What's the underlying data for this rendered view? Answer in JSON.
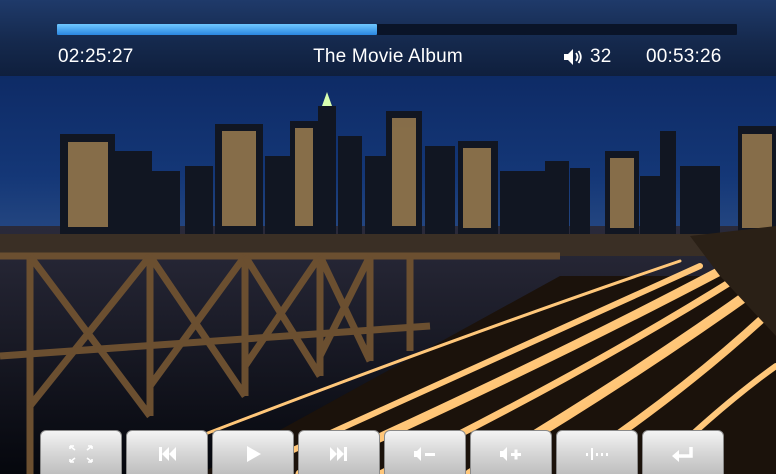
{
  "player": {
    "title": "The Movie Album",
    "elapsed": "02:25:27",
    "remaining": "00:53:26",
    "volume": "32",
    "progress_fraction": 0.47,
    "accent_color": "#3a9af0",
    "icons": {
      "volume": "speaker-icon"
    }
  },
  "controls": {
    "buttons": [
      {
        "name": "fullscreen-button",
        "icon": "expand-arrows-icon"
      },
      {
        "name": "previous-button",
        "icon": "skip-back-icon"
      },
      {
        "name": "play-button",
        "icon": "play-icon"
      },
      {
        "name": "next-button",
        "icon": "skip-forward-icon"
      },
      {
        "name": "volume-down-button",
        "icon": "volume-minus-icon"
      },
      {
        "name": "volume-up-button",
        "icon": "volume-plus-icon"
      },
      {
        "name": "equalizer-button",
        "icon": "equalizer-icon"
      },
      {
        "name": "back-button",
        "icon": "return-arrow-icon"
      }
    ]
  }
}
